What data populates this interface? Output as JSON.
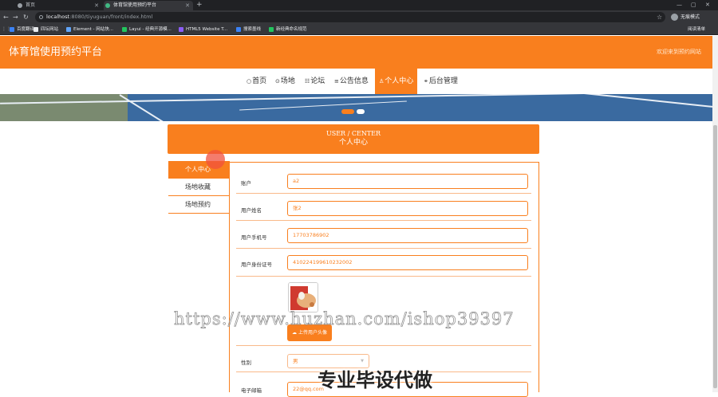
{
  "browser": {
    "tabs": [
      {
        "label": "首页",
        "active": false
      },
      {
        "label": "体育馆使用预约平台",
        "active": true
      }
    ],
    "new_tab": "+",
    "window_controls": [
      "—",
      "▢",
      "✕"
    ],
    "url_host": "localhost",
    "url_rest": ":8080/tiyuguan/front/index.html",
    "profile_label": "无痕模式",
    "bookmarks": [
      {
        "label": "百度翻译",
        "color": "#3b82f6"
      },
      {
        "label": "四坛网站",
        "color": "#e8eaed"
      },
      {
        "label": "Element - 网站快...",
        "color": "#60a5fa"
      },
      {
        "label": "Layui - 经典开源模...",
        "color": "#22c55e"
      },
      {
        "label": "HTML5 Website T...",
        "color": "#8b5cf6"
      },
      {
        "label": "搜索墨线",
        "color": "#3b82f6"
      },
      {
        "label": "新经典命名规范",
        "color": "#22c55e"
      }
    ],
    "reading_list": "阅读清单"
  },
  "site": {
    "title": "体育馆使用预约平台",
    "welcome": "欢迎来到预约网站",
    "accent": "#f97f1e"
  },
  "nav": [
    {
      "icon": "home-icon",
      "glyph": "○",
      "label": "首页",
      "active": false
    },
    {
      "icon": "venue-icon",
      "glyph": "⊙",
      "label": "场地",
      "active": false
    },
    {
      "icon": "forum-icon",
      "glyph": "☷",
      "label": "论坛",
      "active": false
    },
    {
      "icon": "notice-icon",
      "glyph": "≡",
      "label": "公告信息",
      "active": false
    },
    {
      "icon": "user-icon",
      "glyph": "♙",
      "label": "个人中心",
      "active": true
    },
    {
      "icon": "link-icon",
      "glyph": "⚭",
      "label": "后台管理",
      "active": false
    }
  ],
  "center": {
    "title_en": "USER / CENTER",
    "title_cn": "个人中心"
  },
  "side_menu": [
    {
      "label": "个人中心",
      "active": true
    },
    {
      "label": "场地收藏",
      "active": false
    },
    {
      "label": "场地预约",
      "active": false
    }
  ],
  "form": {
    "account": {
      "label": "账户",
      "value": "a2"
    },
    "name": {
      "label": "用户姓名",
      "value": "张2"
    },
    "phone": {
      "label": "用户手机号",
      "value": "17703786902"
    },
    "id_card": {
      "label": "用户身份证号",
      "value": "410224199610232002"
    },
    "upload_label": "上传用户头像",
    "gender": {
      "label": "性别",
      "value": "男"
    },
    "email": {
      "label": "电子邮箱",
      "value": "22@qq.com"
    }
  },
  "overlay": {
    "watermark_url": "https://www.huzhan.com/ishop39397",
    "watermark_cn": "专业毕设代做"
  }
}
